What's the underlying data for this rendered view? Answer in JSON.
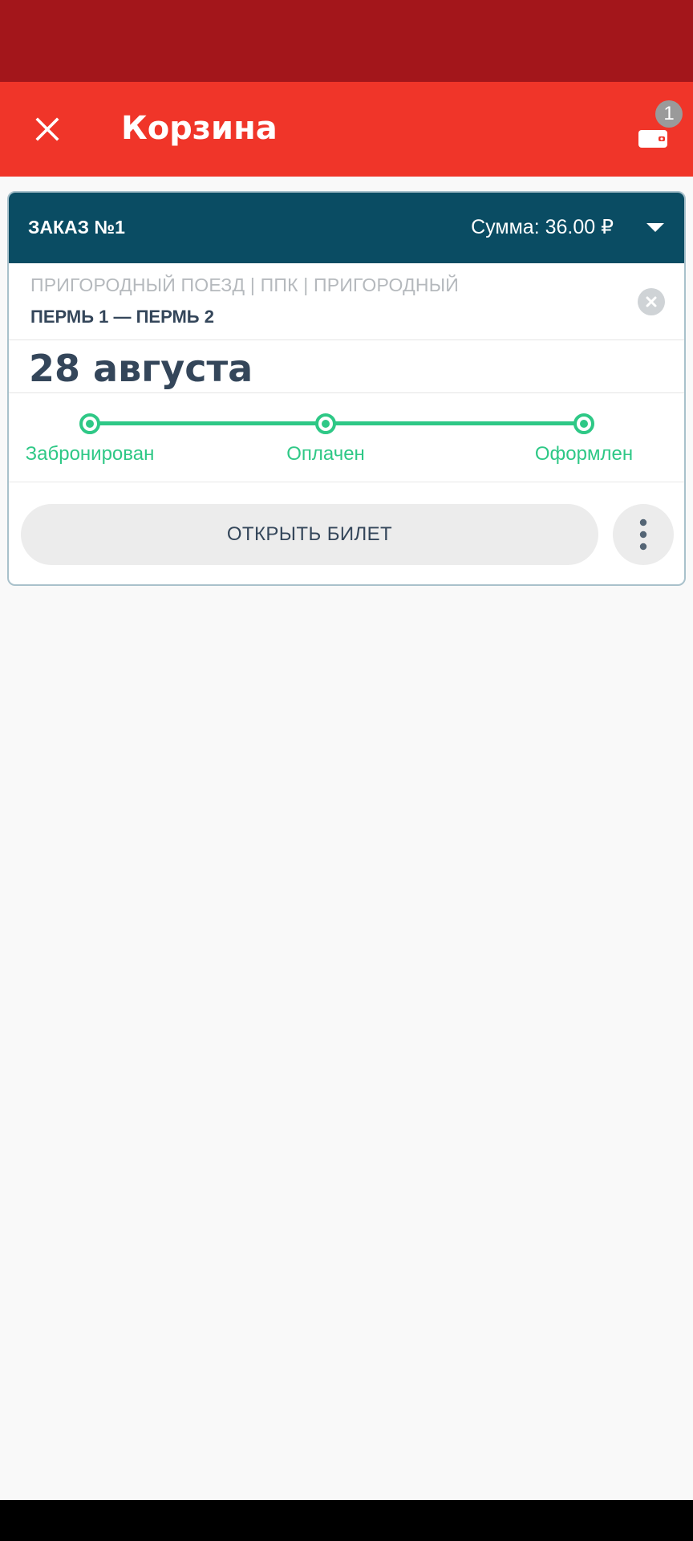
{
  "app_bar": {
    "title": "Корзина",
    "close_icon": "close-icon",
    "wallet_icon": "wallet-icon",
    "wallet_badge": "1"
  },
  "order": {
    "title": "ЗАКАЗ №1",
    "sum": "Сумма: 36.00 ₽",
    "expand_icon": "chevron-down-icon",
    "train_type": "ПРИГОРОДНЫЙ ПОЕЗД | ППК | ПРИГОРОДНЫЙ",
    "route": "ПЕРМЬ 1 — ПЕРМЬ 2",
    "remove_icon": "remove-icon",
    "date": "28 августа",
    "steps": [
      "Забронирован",
      "Оплачен",
      "Оформлен"
    ],
    "open_ticket_label": "ОТКРЫТЬ БИЛЕТ",
    "more_icon": "more-vertical-icon"
  },
  "colors": {
    "status_bar": "#a3161b",
    "app_bar": "#f03529",
    "order_header": "#0a4c63",
    "progress": "#2ec886",
    "text_dark": "#34465a",
    "text_muted": "#b5b9bd"
  }
}
